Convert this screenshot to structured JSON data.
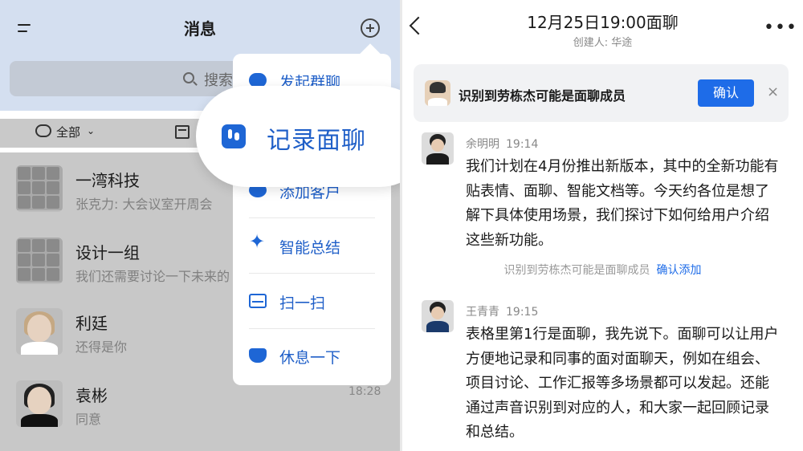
{
  "left": {
    "title": "消息",
    "search_placeholder": "搜索",
    "filter_label": "全部",
    "filter_caret": "⌄",
    "chats": [
      {
        "name": "一湾科技",
        "preview": "张克力: 大会议室开周会",
        "time": ""
      },
      {
        "name": "设计一组",
        "preview": "我们还需要讨论一下未来的",
        "time": ""
      },
      {
        "name": "利廷",
        "preview": "还得是你",
        "time": ""
      },
      {
        "name": "袁彬",
        "preview": "同意",
        "time": "18:28"
      }
    ],
    "popup": {
      "items": [
        {
          "label": "发起群聊",
          "icon": "chat-bubble-icon"
        },
        {
          "label": "添加客户",
          "icon": "add-contact-icon"
        },
        {
          "label": "智能总结",
          "icon": "sparkle-icon"
        },
        {
          "label": "扫一扫",
          "icon": "scan-icon"
        },
        {
          "label": "休息一下",
          "icon": "cup-icon"
        }
      ],
      "highlight": {
        "label": "记录面聊",
        "icon": "record-chat-icon"
      }
    }
  },
  "right": {
    "title": "12月25日19:00面聊",
    "subtitle": "创建人: 华途",
    "notice": {
      "text": "识别到劳栋杰可能是面聊成员",
      "button": "确认",
      "close": "×"
    },
    "messages": [
      {
        "sender": "余明明",
        "time": "19:14",
        "body": "我们计划在4月份推出新版本，其中的全新功能有贴表情、面聊、智能文档等。今天约各位是想了解下具体使用场景，我们探讨下如何给用户介绍这些新功能。"
      },
      {
        "sender": "王青青",
        "time": "19:15",
        "body": "表格里第1行是面聊，我先说下。面聊可以让用户方便地记录和同事的面对面聊天，例如在组会、项目讨论、工作汇报等多场景都可以发起。还能通过声音识别到对应的人，和大家一起回顾记录和总结。"
      }
    ],
    "system": {
      "text": "识别到劳栋杰可能是面聊成员",
      "link": "确认添加"
    }
  },
  "colors": {
    "accent": "#1e6ce8",
    "popup_text": "#1f5fc8",
    "topbar_bg": "#d4dff0"
  }
}
